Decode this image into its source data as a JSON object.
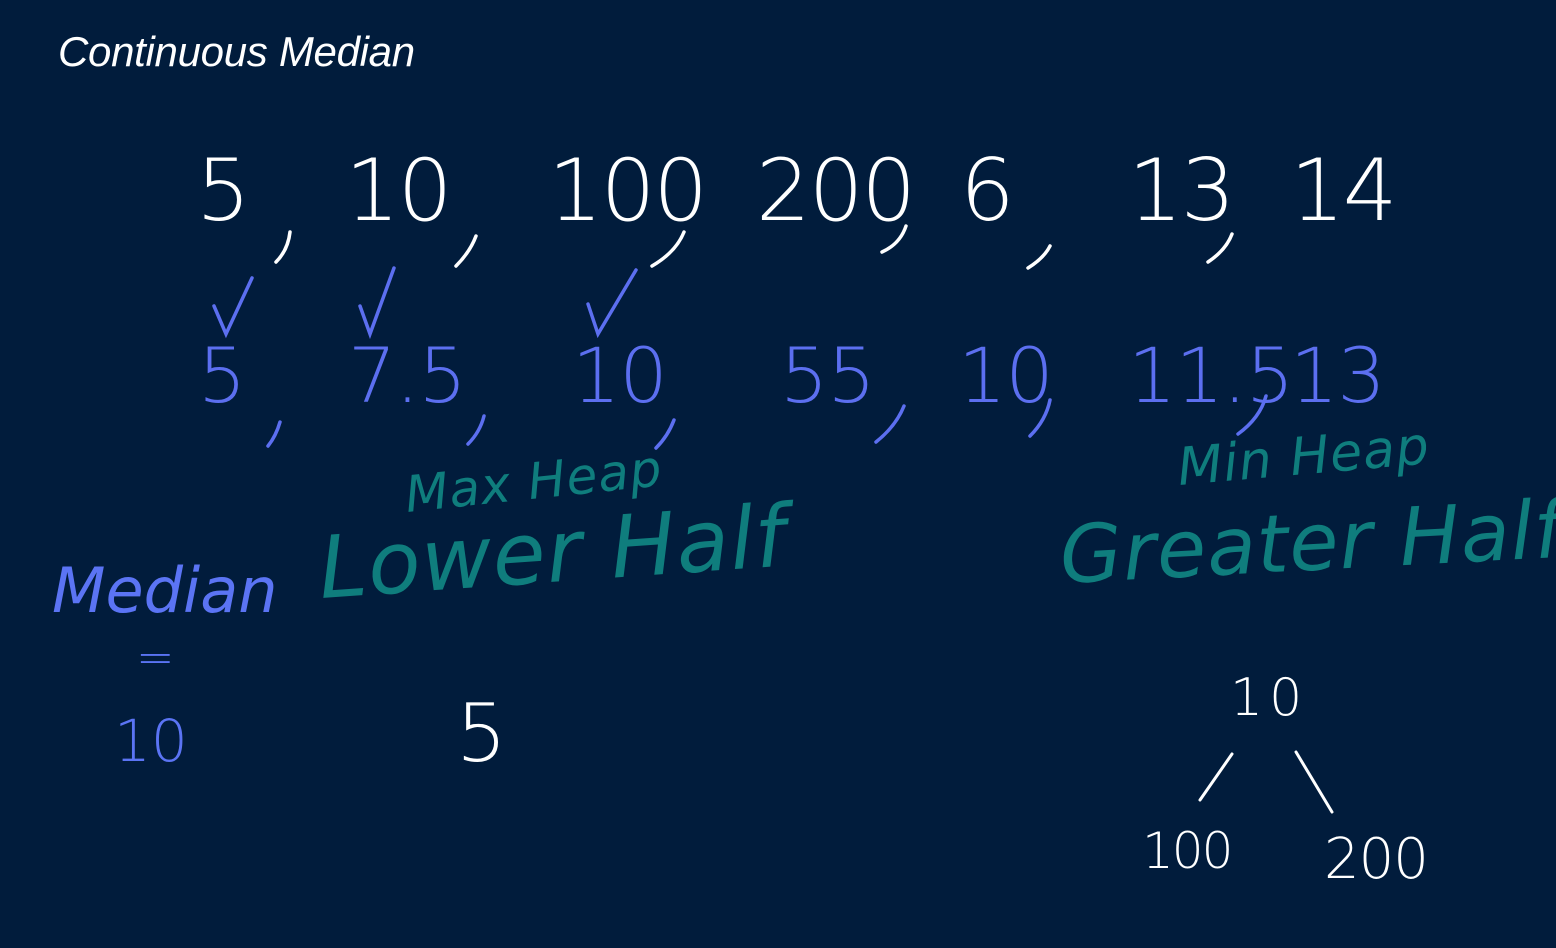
{
  "title": "Continuous Median",
  "colors": {
    "background": "#011c3c",
    "sequence": "#ffffff",
    "running_median": "#5c6ff0",
    "heap_label": "#0f7d7d",
    "median_label": "#5b74f4"
  },
  "sequence": [
    "5",
    "10",
    "100",
    "200",
    "6",
    "13",
    "14"
  ],
  "running_medians": [
    "5",
    "7.5",
    "10",
    "55",
    "10",
    "11.5",
    "13"
  ],
  "max_heap": {
    "type_label": "Max Heap",
    "half_label": "Lower Half",
    "nodes": [
      "5"
    ]
  },
  "min_heap": {
    "type_label": "Min Heap",
    "half_label": "Greater Half",
    "root": "10",
    "children": [
      "100",
      "200"
    ]
  },
  "median": {
    "label": "Median",
    "equals": "=",
    "value": "10"
  },
  "checkmark_icon": "check-icon"
}
